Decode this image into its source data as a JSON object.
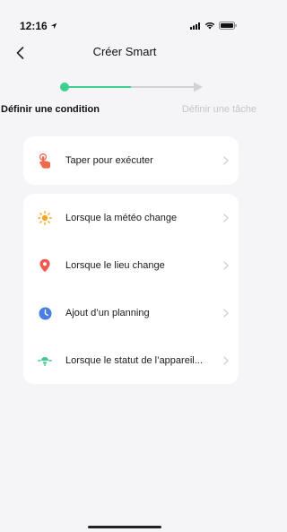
{
  "status_bar": {
    "time": "12:16"
  },
  "nav": {
    "title": "Créer Smart"
  },
  "stepper": {
    "step1_label": "Définir une condition",
    "step2_label": "Définir une tâche"
  },
  "quick_action": {
    "label": "Taper pour exécuter",
    "icon": "tap-hand-icon"
  },
  "conditions": [
    {
      "label": "Lorsque la météo change",
      "icon": "weather-sun-icon",
      "color": "#f5a623"
    },
    {
      "label": "Lorsque le lieu change",
      "icon": "location-pin-icon",
      "color": "#ef5a50"
    },
    {
      "label": "Ajout d’un planning",
      "icon": "clock-icon",
      "color": "#4a7fe0"
    },
    {
      "label": "Lorsque le statut de l’appareil...",
      "icon": "device-status-icon",
      "color": "#3fc98c"
    }
  ],
  "colors": {
    "accent": "#3fcf8e",
    "background": "#f5f5f7",
    "inactive": "#c5c5c8"
  }
}
